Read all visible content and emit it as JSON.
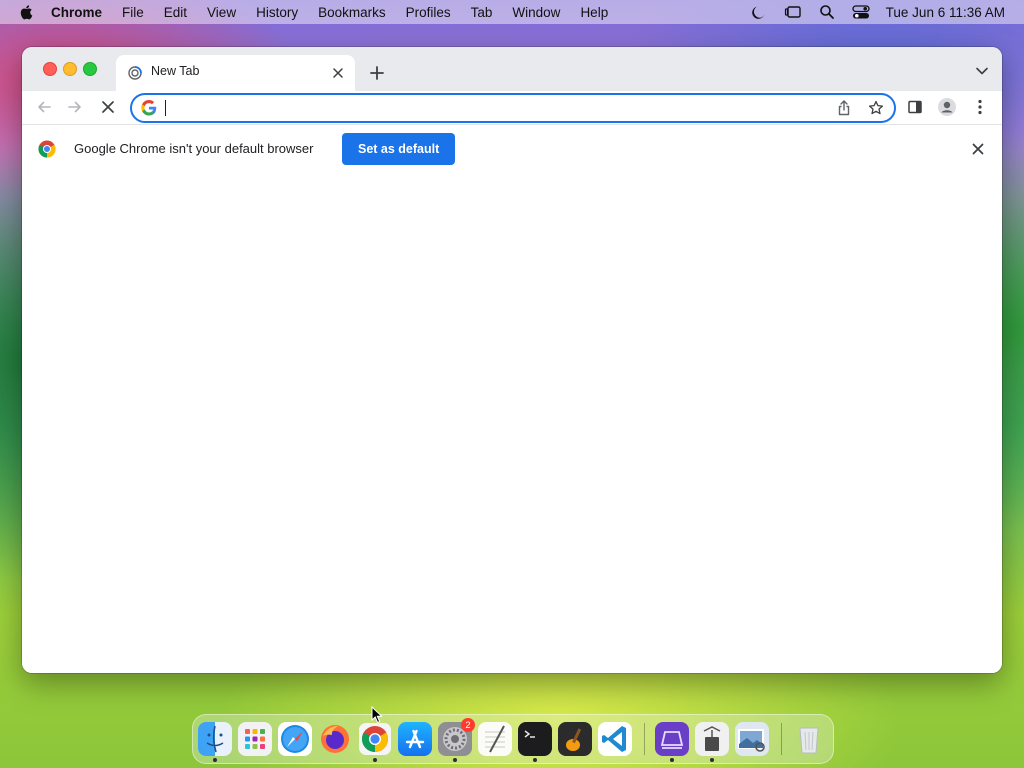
{
  "menubar": {
    "app_name": "Chrome",
    "menus": [
      "File",
      "Edit",
      "View",
      "History",
      "Bookmarks",
      "Profiles",
      "Tab",
      "Window",
      "Help"
    ],
    "clock": "Tue Jun 6  11:36 AM"
  },
  "browser": {
    "tab": {
      "title": "New Tab"
    },
    "omnibox": {
      "value": "",
      "placeholder": ""
    },
    "infobar": {
      "message": "Google Chrome isn't your default browser",
      "button_label": "Set as default"
    }
  },
  "dock": {
    "apps": [
      {
        "icon": "finder-icon",
        "running": true
      },
      {
        "icon": "launchpad-icon",
        "running": false
      },
      {
        "icon": "safari-icon",
        "running": false
      },
      {
        "icon": "firefox-icon",
        "running": false
      },
      {
        "icon": "chrome-icon",
        "running": true
      },
      {
        "icon": "app-store-icon",
        "running": false
      },
      {
        "icon": "system-settings-icon",
        "running": true,
        "badge": "2"
      },
      {
        "icon": "textedit-icon",
        "running": false
      },
      {
        "icon": "terminal-icon",
        "running": true
      },
      {
        "icon": "garageband-icon",
        "running": false
      },
      {
        "icon": "vscode-icon",
        "running": false
      },
      {
        "icon": "simulator-icon",
        "running": true
      },
      {
        "icon": "archive-utility-icon",
        "running": true
      },
      {
        "icon": "preview-icon",
        "running": false
      },
      {
        "icon": "trash-icon",
        "running": false
      }
    ]
  },
  "colors": {
    "accent": "#1a73e8",
    "tabstrip": "#e8eaed",
    "traffic_red": "#ff5f57",
    "traffic_yellow": "#febc2e",
    "traffic_green": "#28c840"
  }
}
